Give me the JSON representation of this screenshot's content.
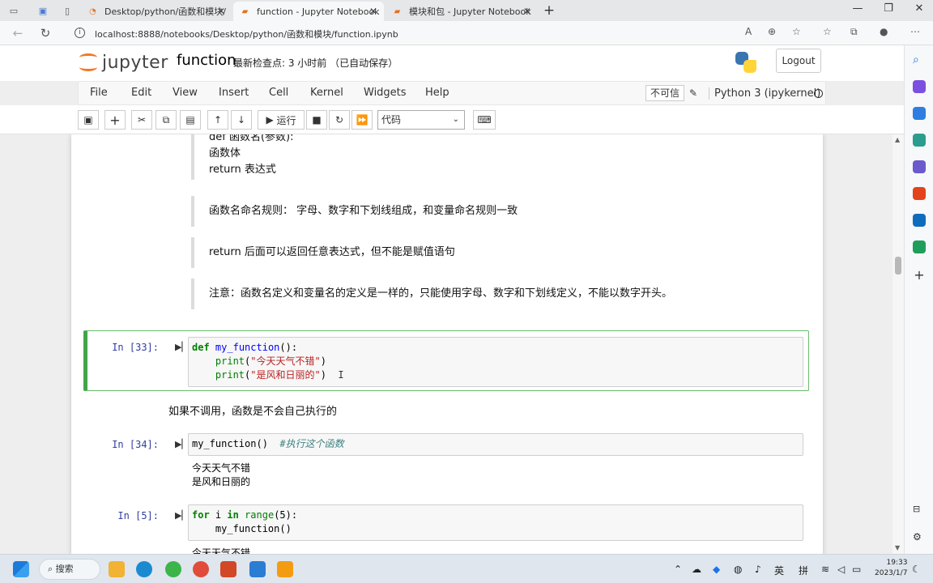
{
  "browser": {
    "tabs": [
      {
        "title": "Desktop/python/函数和模块/",
        "active": false
      },
      {
        "title": "function - Jupyter Notebook",
        "active": true
      },
      {
        "title": "模块和包 - Jupyter Notebook",
        "active": false
      }
    ],
    "address": "localhost:8888/notebooks/Desktop/python/函数和模块/function.ipynb"
  },
  "header": {
    "logo_text": "jupyter",
    "notebook_name": "function",
    "checkpoint": "最新检查点: 3 小时前 （已自动保存）",
    "logout_label": "Logout"
  },
  "menu": {
    "items": [
      "File",
      "Edit",
      "View",
      "Insert",
      "Cell",
      "Kernel",
      "Widgets",
      "Help"
    ],
    "trust_label": "不可信",
    "kernel_name": "Python 3 (ipykernel)"
  },
  "toolbar": {
    "run_label": "运行",
    "cell_type": "代码"
  },
  "cells": {
    "md_syntax": {
      "line1": "def 函数名(参数):",
      "line2": "函数体",
      "line3": "return 表达式"
    },
    "md_rule": "函数名命名规则： 字母、数字和下划线组成，和变量命名规则一致",
    "md_return": "return 后面可以返回任意表达式，但不能是赋值语句",
    "md_note": "注意：函数名定义和变量名的定义是一样的，只能使用字母、数字和下划线定义，不能以数字开头。",
    "cell33": {
      "prompt": "In  [33]:"
    },
    "md_call": "如果不调用，函数是不会自己执行的",
    "cell34": {
      "prompt": "In  [34]:",
      "comment": "#执行这个函数",
      "out1": "今天天气不错",
      "out2": "是风和日丽的"
    },
    "cell5": {
      "prompt": "In  [5]:",
      "out_partial": "今天天气不错"
    }
  },
  "taskbar": {
    "search_label": "搜索",
    "ime1": "英",
    "ime2": "拼",
    "time": "19:33",
    "date": "2023/1/7"
  }
}
